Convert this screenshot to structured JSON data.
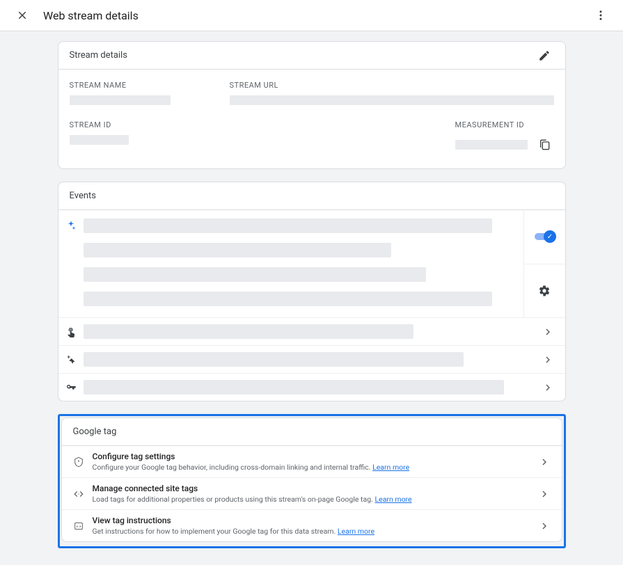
{
  "header": {
    "title": "Web stream details"
  },
  "stream_details": {
    "section_title": "Stream details",
    "stream_name_label": "STREAM NAME",
    "stream_url_label": "STREAM URL",
    "stream_id_label": "STREAM ID",
    "measurement_id_label": "MEASUREMENT ID"
  },
  "events": {
    "section_title": "Events"
  },
  "google_tag": {
    "section_title": "Google tag",
    "rows": [
      {
        "title": "Configure tag settings",
        "desc": "Configure your Google tag behavior, including cross-domain linking and internal traffic. ",
        "learn": "Learn more"
      },
      {
        "title": "Manage connected site tags",
        "desc": "Load tags for additional properties or products using this stream's on-page Google tag. ",
        "learn": "Learn more"
      },
      {
        "title": "View tag instructions",
        "desc": "Get instructions for how to implement your Google tag for this data stream. ",
        "learn": "Learn more"
      }
    ]
  }
}
